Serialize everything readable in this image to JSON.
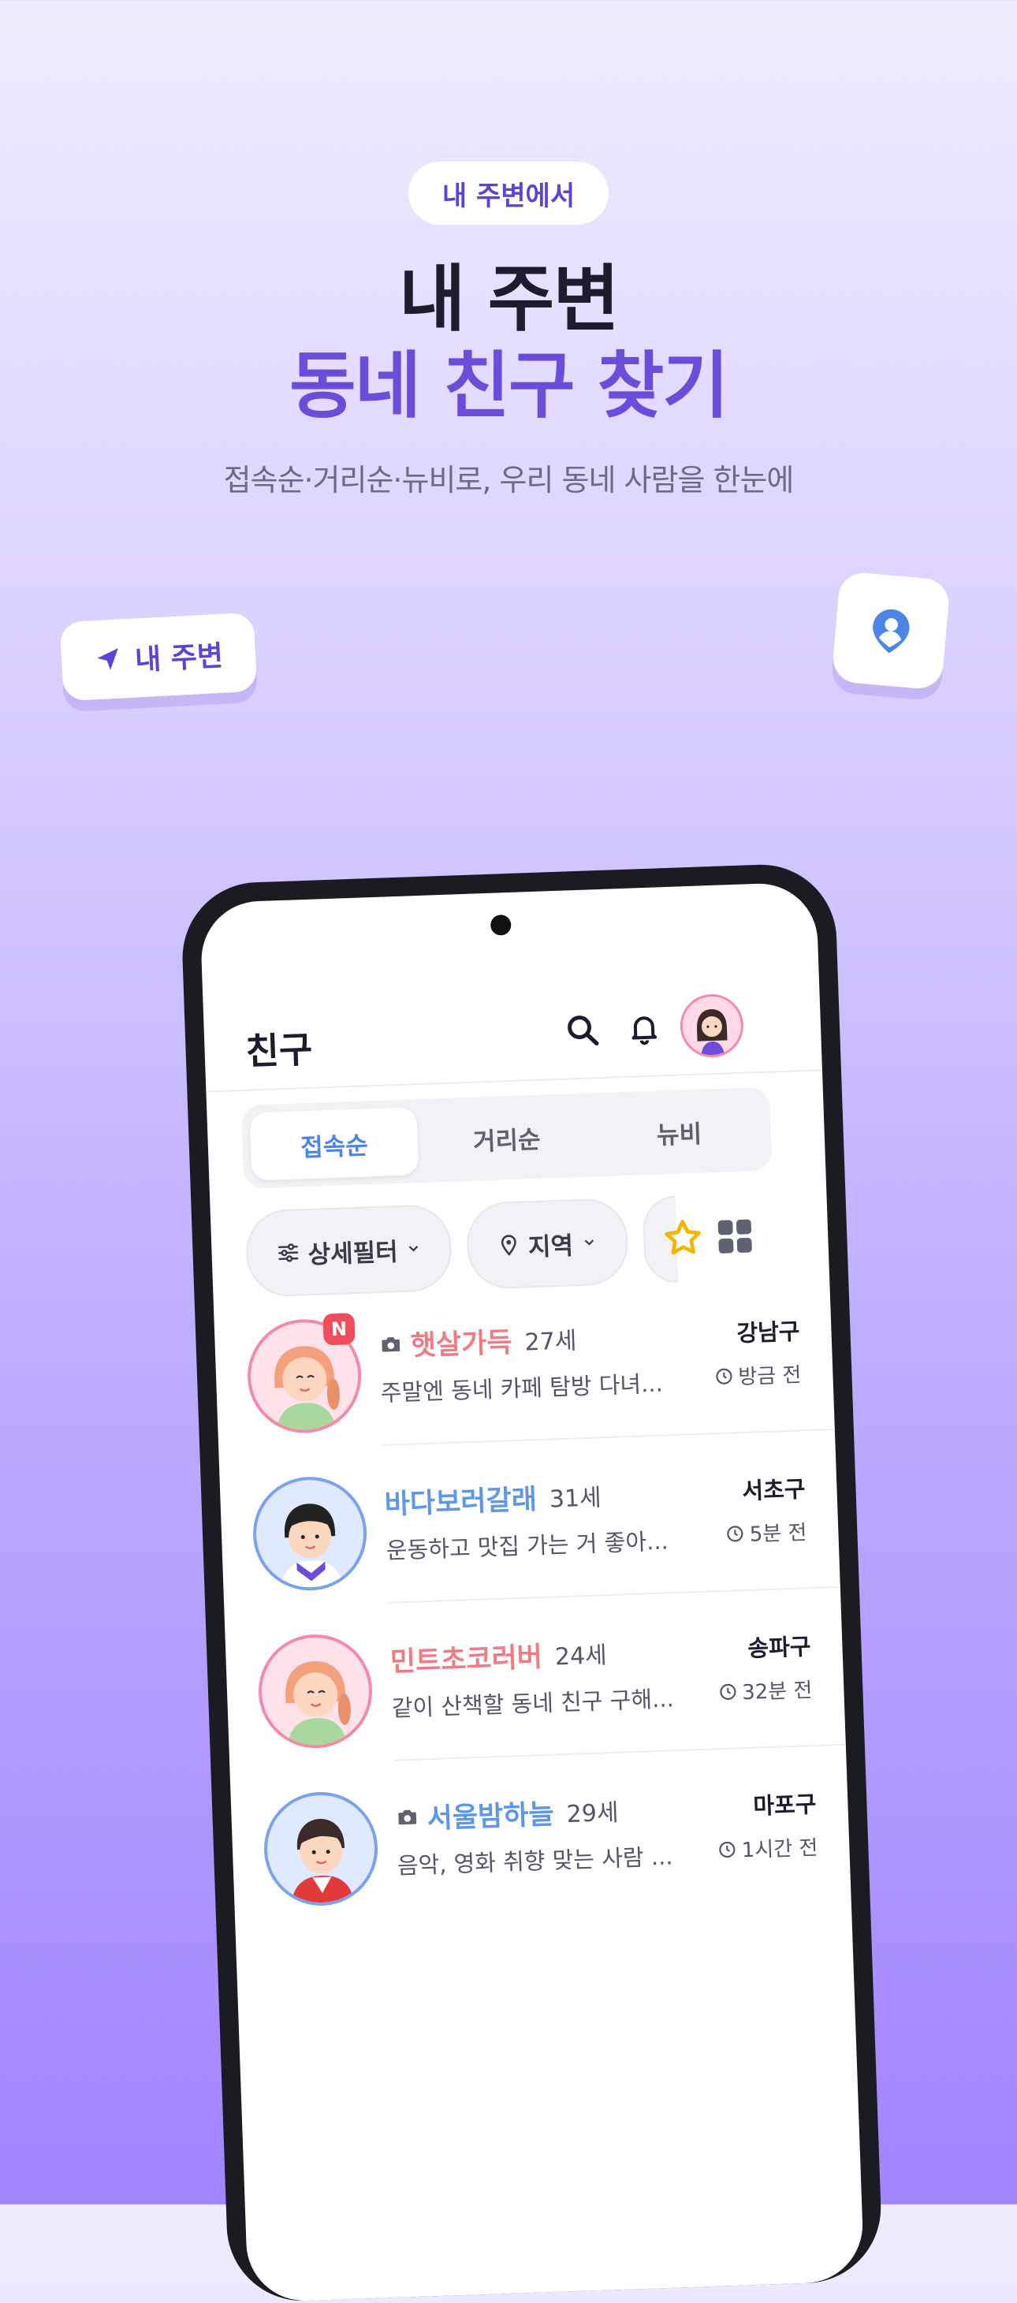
{
  "hero": {
    "pill": "내 주변에서",
    "title_line1": "내 주변",
    "title_line2": "동네 친구 찾기",
    "subtitle": "접속순·거리순·뉴비로, 우리 동네 사람을 한눈에",
    "chip_left": "내 주변",
    "chip_left_icon": "navigation-arrow-icon",
    "chip_right_icon": "location-person-icon"
  },
  "app": {
    "title": "친구",
    "header_icons": [
      "search-icon",
      "bell-icon",
      "profile-avatar"
    ],
    "sort_tabs": [
      {
        "label": "접속순",
        "active": true
      },
      {
        "label": "거리순",
        "active": false
      },
      {
        "label": "뉴비",
        "active": false
      }
    ],
    "filters": {
      "detail": "상세필터",
      "region": "지역"
    },
    "colors": {
      "accent": "#6a4ed9",
      "tab_active": "#4b86e6",
      "pink": "#f27a83",
      "blue": "#5c97e8",
      "star": "#f4b400"
    },
    "friends": [
      {
        "nickname": "햇살가득",
        "age": "27세",
        "message": "주말엔 동네 카페 탐방 다녀...",
        "region": "강남구",
        "time": "방금 전",
        "gender": "female",
        "has_photo": true,
        "is_new": true,
        "badge": "N"
      },
      {
        "nickname": "바다보러갈래",
        "age": "31세",
        "message": "운동하고 맛집 가는 거 좋아...",
        "region": "서초구",
        "time": "5분 전",
        "gender": "male",
        "has_photo": false,
        "is_new": false
      },
      {
        "nickname": "민트초코러버",
        "age": "24세",
        "message": "같이 산책할 동네 친구 구해...",
        "region": "송파구",
        "time": "32분 전",
        "gender": "female",
        "has_photo": false,
        "is_new": false
      },
      {
        "nickname": "서울밤하늘",
        "age": "29세",
        "message": "음악, 영화 취향 맞는 사람 ...",
        "region": "마포구",
        "time": "1시간 전",
        "gender": "male",
        "has_photo": true,
        "is_new": false
      }
    ]
  }
}
